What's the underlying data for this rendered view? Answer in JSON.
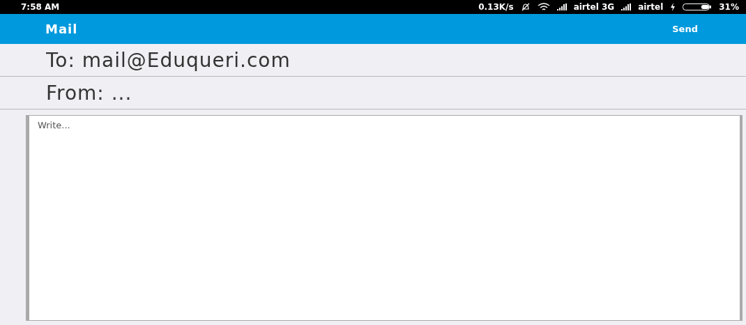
{
  "status_bar": {
    "time": "7:58 AM",
    "speed": "0.13K/s",
    "carrier_1": "airtel 3G",
    "carrier_2": "airtel",
    "battery": {
      "reading": "31%",
      "level": 0.31
    }
  },
  "app_bar": {
    "title": "Mail",
    "action": "Send"
  },
  "to": {
    "value": "To: mail@Eduqueri.com"
  },
  "from": {
    "value": "From: ..."
  },
  "body": {
    "placeholder": "Write..."
  }
}
